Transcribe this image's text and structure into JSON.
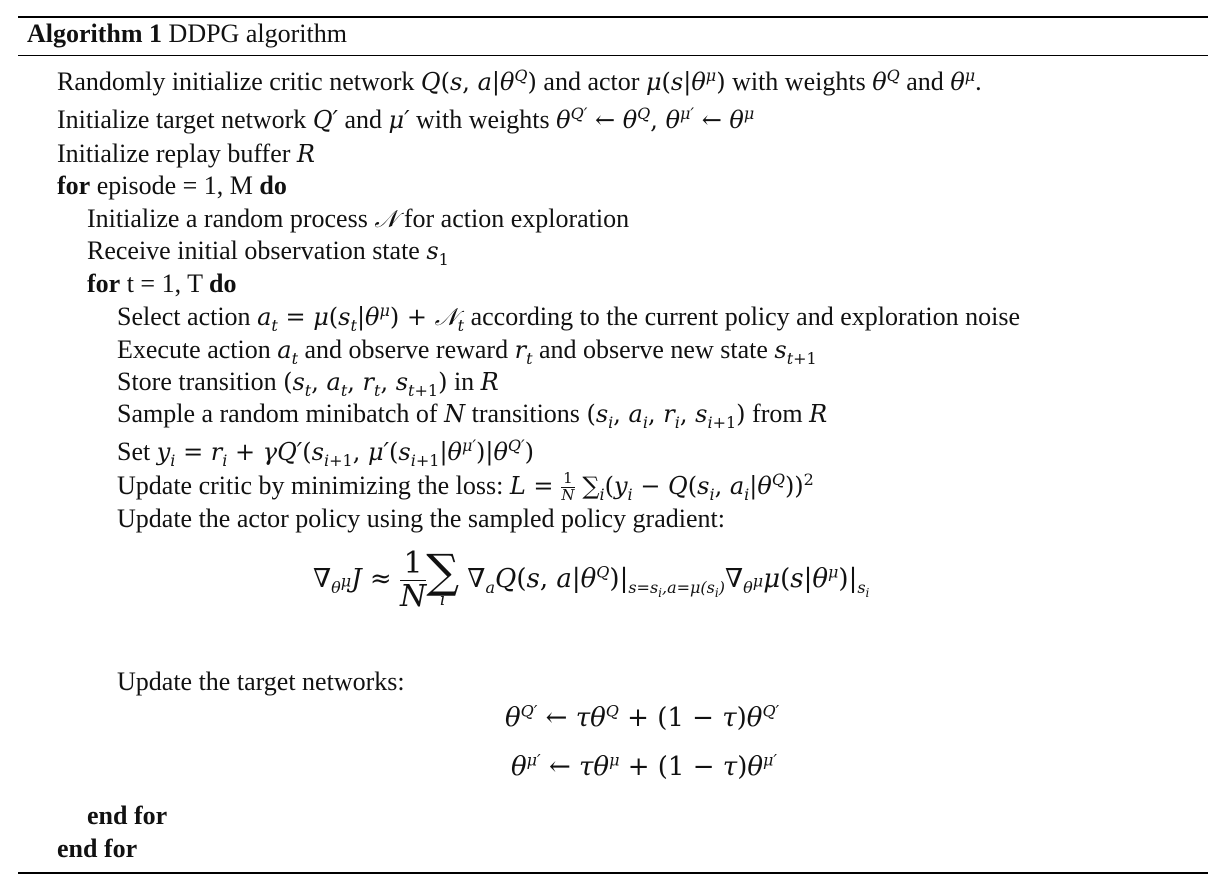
{
  "algorithm": {
    "label": "Algorithm 1",
    "title": "DDPG algorithm",
    "lines": [
      {
        "id": "init-critic-actor",
        "text": "Randomly initialize critic network Q(s, a|θ^Q) and actor μ(s|θ^μ) with weights θ^Q and θ^μ."
      },
      {
        "id": "init-target",
        "text": "Initialize target network Q′ and μ′ with weights θ^{Q′} ← θ^Q, θ^{μ′} ← θ^μ"
      },
      {
        "id": "init-replay",
        "text": "Initialize replay buffer R"
      },
      {
        "id": "for-episode",
        "text": "for episode = 1, M do"
      },
      {
        "id": "init-noise",
        "text": "Initialize a random process 𝒩 for action exploration"
      },
      {
        "id": "receive-state",
        "text": "Receive initial observation state s_1"
      },
      {
        "id": "for-t",
        "text": "for t = 1, T do"
      },
      {
        "id": "select-action",
        "text": "Select action a_t = μ(s_t|θ^μ) + 𝒩_t according to the current policy and exploration noise"
      },
      {
        "id": "execute-action",
        "text": "Execute action a_t and observe reward r_t and observe new state s_{t+1}"
      },
      {
        "id": "store-transition",
        "text": "Store transition (s_t, a_t, r_t, s_{t+1}) in R"
      },
      {
        "id": "sample-minibatch",
        "text": "Sample a random minibatch of N transitions (s_i, a_i, r_i, s_{i+1}) from R"
      },
      {
        "id": "set-target",
        "text": "Set y_i = r_i + γQ′(s_{i+1}, μ′(s_{i+1}|θ^{μ′})|θ^{Q′})"
      },
      {
        "id": "update-critic",
        "text": "Update critic by minimizing the loss: L = 1/N Σ_i (y_i − Q(s_i, a_i|θ^Q))^2"
      },
      {
        "id": "update-actor",
        "text": "Update the actor policy using the sampled policy gradient:"
      },
      {
        "id": "policy-gradient",
        "text": "∇_{θ^μ} J ≈ 1/N Σ_i ∇_a Q(s, a|θ^Q)|_{s=s_i, a=μ(s_i)} ∇_{θ^μ} μ(s|θ^μ)|_{s_i}"
      },
      {
        "id": "update-targets",
        "text": "Update the target networks:"
      },
      {
        "id": "soft-update-critic",
        "text": "θ^{Q′} ← τθ^Q + (1 − τ)θ^{Q′}"
      },
      {
        "id": "soft-update-actor",
        "text": "θ^{μ′} ← τθ^μ + (1 − τ)θ^{μ′}"
      },
      {
        "id": "end-for-t",
        "text": "end for"
      },
      {
        "id": "end-for-episode",
        "text": "end for"
      }
    ]
  },
  "words": {
    "randomly_initialize_critic": "Randomly initialize critic network ",
    "and_actor": " and actor ",
    "with_weights": " with weights ",
    "and": " and ",
    "initialize_target_network": "Initialize target network ",
    "initialize_replay_buffer": "Initialize replay buffer ",
    "for": "for",
    "episode_range": " episode = 1, M ",
    "do": "do",
    "initialize_random_process": "Initialize a random process ",
    "for_action_exploration": " for action exploration",
    "receive_initial_observation": "Receive initial observation state ",
    "t_range": " t = 1, T ",
    "select_action": "Select action ",
    "according_to": " according to the current policy and exploration noise",
    "execute_action": "Execute action ",
    "and_observe_reward": " and observe reward ",
    "and_observe_new_state": " and observe new state ",
    "store_transition": "Store transition ",
    "in": " in ",
    "sample_minibatch": "Sample a random minibatch of ",
    "transitions": " transitions ",
    "from": " from ",
    "set": "Set ",
    "update_critic": "Update critic by minimizing the loss: ",
    "update_actor": "Update the actor policy using the sampled policy gradient:",
    "update_targets": "Update the target networks:",
    "end_for": "end for"
  }
}
